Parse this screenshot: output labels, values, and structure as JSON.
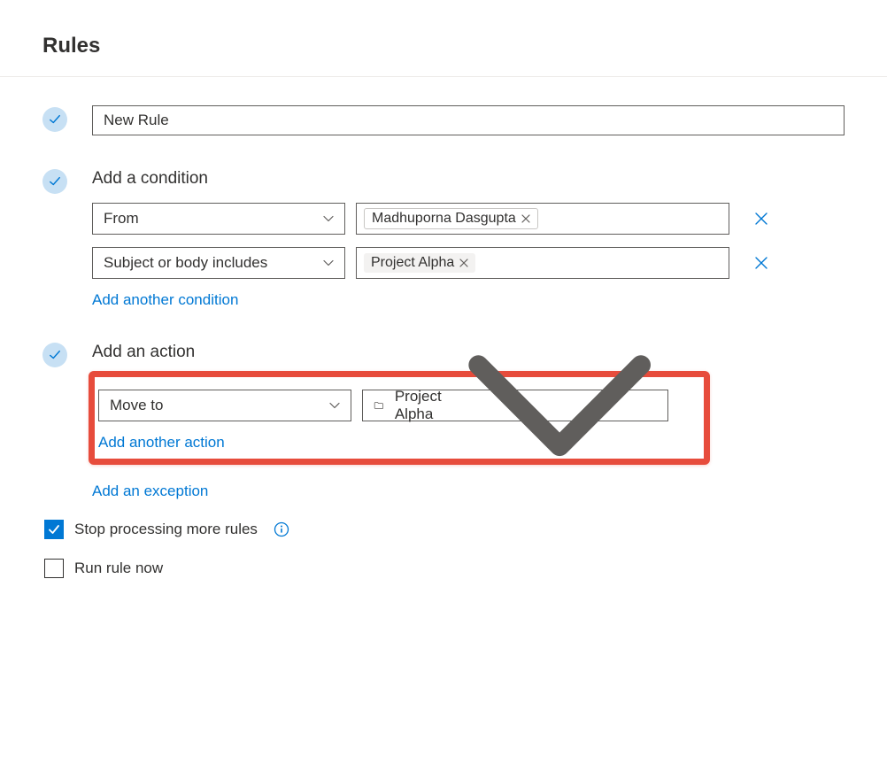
{
  "title": "Rules",
  "rule_name": "New Rule",
  "sections": {
    "condition_heading": "Add a condition",
    "action_heading": "Add an action"
  },
  "conditions": [
    {
      "type": "From",
      "chip": "Madhuporna Dasgupta",
      "chip_kind": "person"
    },
    {
      "type": "Subject or body includes",
      "chip": "Project Alpha",
      "chip_kind": "text"
    }
  ],
  "add_condition_link": "Add another condition",
  "actions": [
    {
      "type": "Move to",
      "folder": "Project Alpha"
    }
  ],
  "add_action_link": "Add another action",
  "add_exception_link": "Add an exception",
  "options": {
    "stop_processing": {
      "label": "Stop processing more rules",
      "checked": true
    },
    "run_now": {
      "label": "Run rule now",
      "checked": false
    }
  }
}
